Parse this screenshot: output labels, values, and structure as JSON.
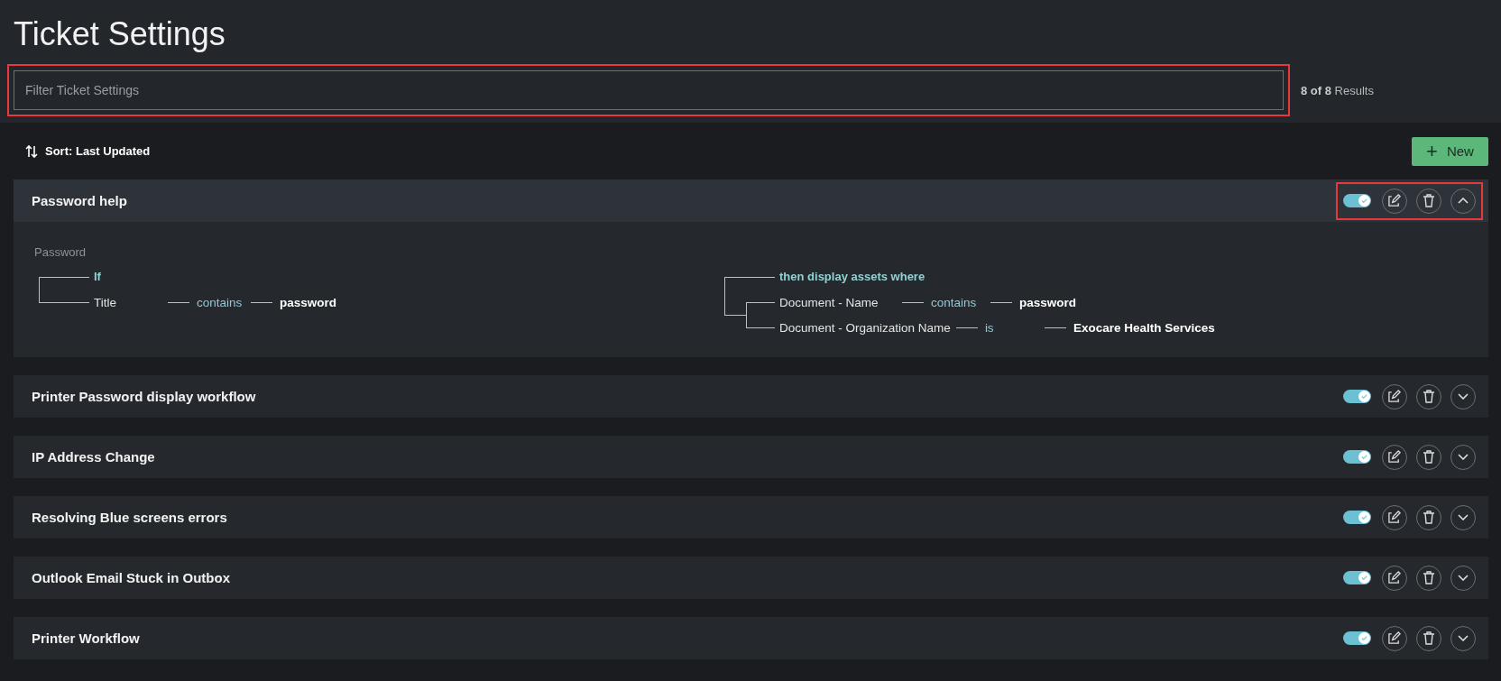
{
  "page": {
    "title": "Ticket Settings"
  },
  "filter": {
    "placeholder": "Filter Ticket Settings",
    "highlighted": true
  },
  "results": {
    "count": "8 of 8",
    "label": "Results"
  },
  "sort": {
    "label": "Sort: Last Updated"
  },
  "new_button": {
    "icon": "+",
    "label": "New"
  },
  "rules": [
    {
      "name": "Password help",
      "enabled": true,
      "expanded": true,
      "highlighted": true,
      "detail": {
        "label": "Password",
        "if": {
          "label": "If",
          "conditions": [
            {
              "field": "Title",
              "operator": "contains",
              "value": "password"
            }
          ]
        },
        "then": {
          "label": "then display assets where",
          "conditions": [
            {
              "field": "Document - Name",
              "operator": "contains",
              "value": "password"
            },
            {
              "field": "Document - Organization Name",
              "operator": "is",
              "value": "Exocare Health Services"
            }
          ]
        }
      }
    },
    {
      "name": "Printer Password display workflow",
      "enabled": true,
      "expanded": false,
      "highlighted": false
    },
    {
      "name": "IP Address Change",
      "enabled": true,
      "expanded": false,
      "highlighted": false
    },
    {
      "name": "Resolving Blue screens errors",
      "enabled": true,
      "expanded": false,
      "highlighted": false
    },
    {
      "name": "Outlook Email Stuck in Outbox",
      "enabled": true,
      "expanded": false,
      "highlighted": false
    },
    {
      "name": "Printer Workflow",
      "enabled": true,
      "expanded": false,
      "highlighted": false
    }
  ]
}
